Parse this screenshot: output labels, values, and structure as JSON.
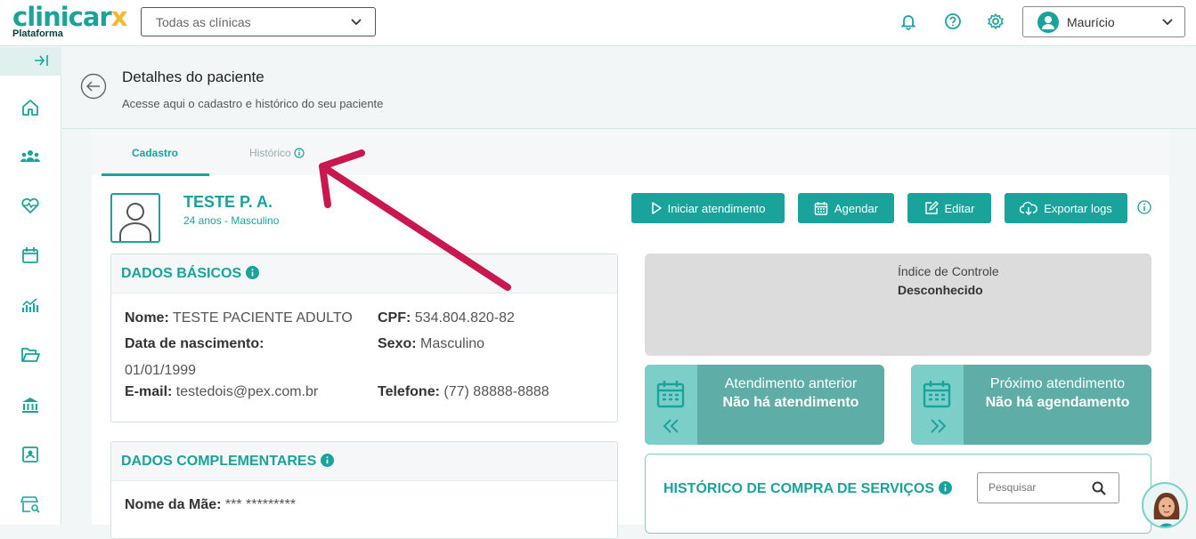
{
  "brand": {
    "logo_main": "clinicar",
    "logo_x": "x",
    "logo_sub": "Plataforma"
  },
  "topbar": {
    "clinic_select": "Todas as clínicas",
    "user_name": "Maurício"
  },
  "header": {
    "title": "Detalhes do paciente",
    "subtitle": "Acesse aqui o cadastro e histórico do seu paciente"
  },
  "tabs": {
    "cadastro": "Cadastro",
    "historico": "Histórico"
  },
  "patient": {
    "name": "TESTE P. A.",
    "info": "24 anos - Masculino"
  },
  "actions": {
    "start": "Iniciar atendimento",
    "schedule": "Agendar",
    "edit": "Editar",
    "export": "Exportar logs"
  },
  "basic": {
    "title": "DADOS BÁSICOS",
    "name_label": "Nome:",
    "name_value": "TESTE PACIENTE ADULTO",
    "cpf_label": "CPF:",
    "cpf_value": "534.804.820-82",
    "birth_label": "Data de nascimento:",
    "birth_value": "01/01/1999",
    "sex_label": "Sexo:",
    "sex_value": "Masculino",
    "email_label": "E-mail:",
    "email_value": "testedois@pex.com.br",
    "phone_label": "Telefone:",
    "phone_value": "(77) 88888-8888"
  },
  "complementary": {
    "title": "DADOS COMPLEMENTARES",
    "mother_label": "Nome da Mãe:",
    "mother_value": "*** *********"
  },
  "control_index": {
    "label": "Índice de Controle",
    "value": "Desconhecido"
  },
  "previous_appt": {
    "label": "Atendimento anterior",
    "value": "Não há atendimento"
  },
  "next_appt": {
    "label": "Próximo atendimento",
    "value": "Não há agendamento"
  },
  "history": {
    "title": "HISTÓRICO DE COMPRA DE SERVIÇOS",
    "search_placeholder": "Pesquisar"
  },
  "colors": {
    "primary": "#1aa39b",
    "accent": "#f5b82e",
    "annotation": "#c8184f"
  }
}
